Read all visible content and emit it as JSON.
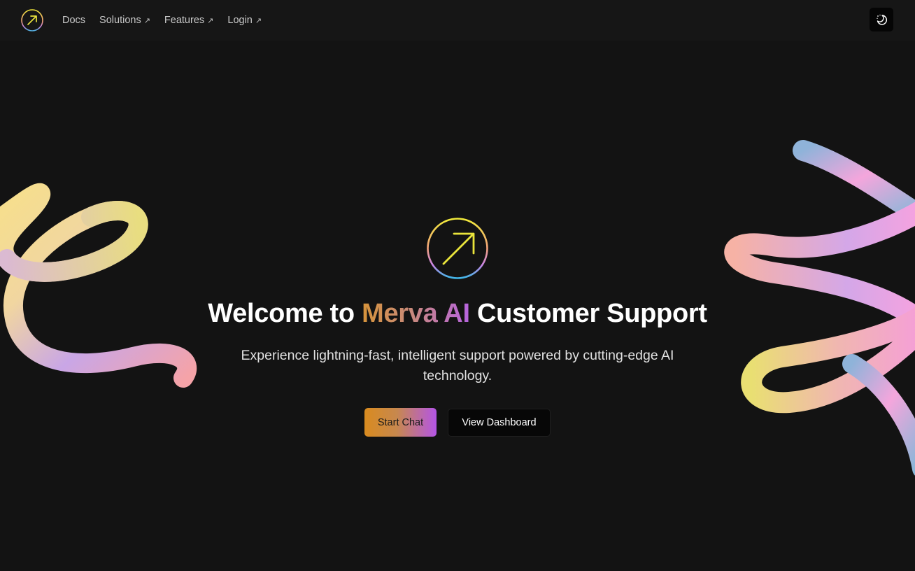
{
  "nav": {
    "logo_icon": "arrow-up-right-circle-icon",
    "links": [
      {
        "label": "Docs",
        "external": false
      },
      {
        "label": "Solutions",
        "external": true
      },
      {
        "label": "Features",
        "external": true
      },
      {
        "label": "Login",
        "external": true
      }
    ],
    "external_glyph": "↗",
    "theme_toggle_icon": "moon-sparkle-icon"
  },
  "hero": {
    "title_prefix": "Welcome to",
    "title_brand": "Merva AI",
    "title_suffix": "Customer Support",
    "subtitle": "Experience lightning-fast, intelligent support powered by cutting-edge AI technology.",
    "primary_button": "Start Chat",
    "secondary_button": "View Dashboard"
  },
  "colors": {
    "background": "#131313",
    "brand_gradient_start": "#d98b1f",
    "brand_gradient_end": "#b455e6",
    "text_primary": "#ffffff"
  }
}
